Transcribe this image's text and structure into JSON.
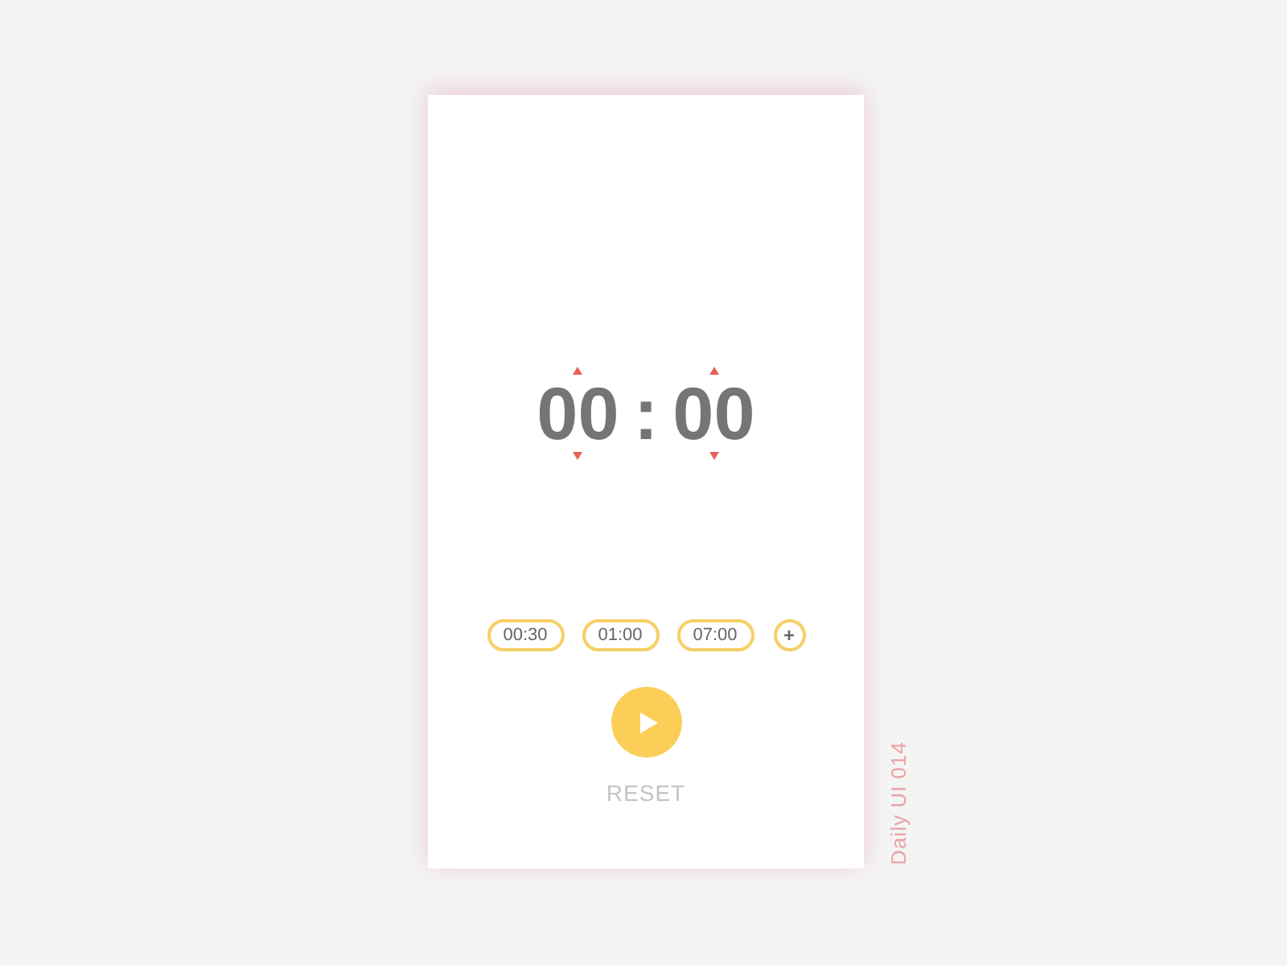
{
  "timer": {
    "minutes": "00",
    "separator": ":",
    "seconds": "00"
  },
  "presets": [
    {
      "label": "00:30"
    },
    {
      "label": "01:00"
    },
    {
      "label": "07:00"
    }
  ],
  "add_button": {
    "label": "+"
  },
  "reset_button": {
    "label": "RESET",
    "disabled": true
  },
  "caption": "Daily UI 014"
}
